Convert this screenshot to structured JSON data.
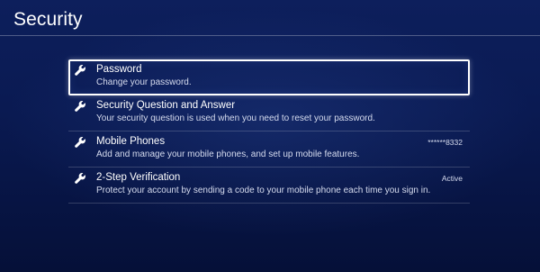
{
  "header": {
    "title": "Security"
  },
  "menu": {
    "items": [
      {
        "title": "Password",
        "description": "Change your password.",
        "value": "",
        "icon": "wrench-icon",
        "selected": true
      },
      {
        "title": "Security Question and Answer",
        "description": "Your security question is used when you need to reset your password.",
        "value": "",
        "icon": "wrench-icon",
        "selected": false
      },
      {
        "title": "Mobile Phones",
        "description": "Add and manage your mobile phones, and set up mobile features.",
        "value": "******8332",
        "icon": "wrench-icon",
        "selected": false
      },
      {
        "title": "2-Step Verification",
        "description": "Protect your account by sending a code to your mobile phone each time you sign in.",
        "value": "Active",
        "icon": "wrench-icon",
        "selected": false
      }
    ]
  },
  "colors": {
    "background_top": "#0d1f5c",
    "background_bottom": "#051038",
    "text_primary": "#ffffff",
    "text_secondary": "#d5dbee",
    "selection_border": "#ffffff"
  }
}
